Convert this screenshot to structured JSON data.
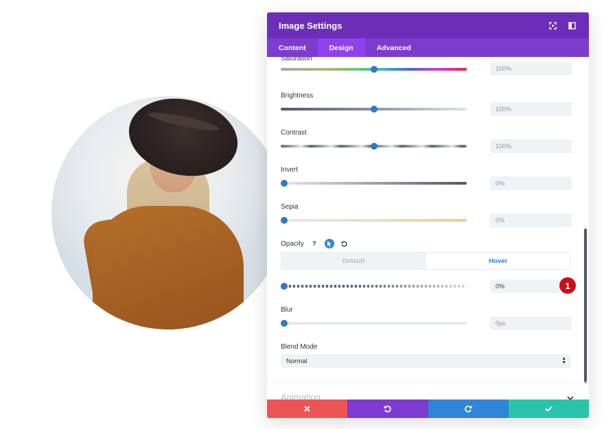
{
  "modal": {
    "title": "Image Settings",
    "tabs": [
      "Content",
      "Design",
      "Advanced"
    ],
    "active_tab": "Design"
  },
  "settings": {
    "saturation": {
      "label": "Saturation",
      "value": "100%",
      "level": 0.5
    },
    "brightness": {
      "label": "Brightness",
      "value": "100%",
      "level": 0.5
    },
    "contrast": {
      "label": "Contrast",
      "value": "100%",
      "level": 0.5
    },
    "invert": {
      "label": "Invert",
      "value": "0%",
      "level": 0
    },
    "sepia": {
      "label": "Sepia",
      "value": "0%",
      "level": 0
    },
    "opacity": {
      "label": "Opacity",
      "toggle_default": "Default",
      "toggle_hover": "Hover",
      "value": "0%",
      "level": 0,
      "help_symbol": "?"
    },
    "blur": {
      "label": "Blur",
      "value": "0px",
      "level": 0
    },
    "blend_mode": {
      "label": "Blend Mode",
      "value": "Normal"
    }
  },
  "annotation": {
    "badge": "1"
  },
  "animation": {
    "title": "Animation"
  },
  "colors": {
    "header": "#6c2eb9",
    "tabs": "#7e3bd0",
    "active_tab": "#8f42ec",
    "knob": "#3278c6",
    "cancel": "#ef5455",
    "reset": "#7d3bcf",
    "redo": "#2f85d6",
    "save": "#29c4a9",
    "badge": "#c8101a"
  }
}
